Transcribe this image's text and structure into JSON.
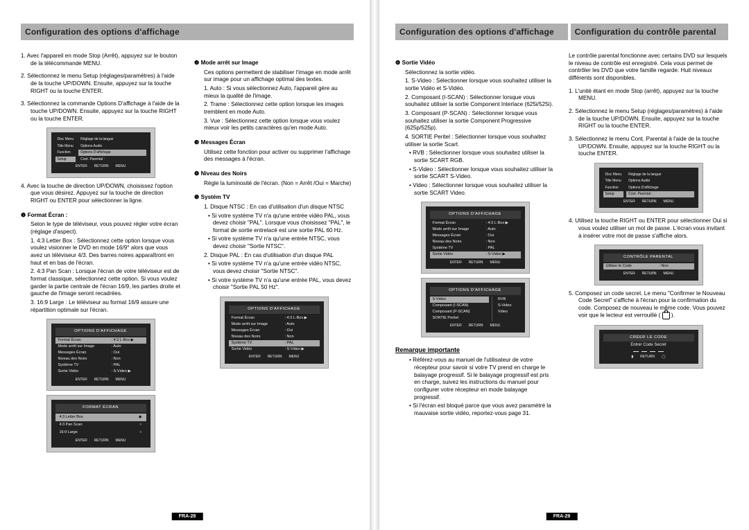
{
  "titles": {
    "leftA": "Configuration des options d'affichage",
    "rightA": "Configuration des options d'affichage",
    "rightB": "Configuration du contrôle parental"
  },
  "pageLeftNum": "FRA-28",
  "pageRightNum": "FRA-29",
  "left": {
    "steps": [
      "1. Avec l'appareil en mode Stop (Arrêt), appuyez sur le bouton de la télécommande MENU.",
      "2. Sélectionnez le menu Setup (réglages/paramètres) à l'aide de la touche UP/DOWN. Ensuite, appuyez sur la touche RIGHT ou la touche ENTER.",
      "3. Sélectionnez la commande Options D'affichage à l'aide de la touche UP/DOWN. Ensuite, appuyez sur la touche RIGHT ou la touche ENTER.",
      "4. Avec la touche de direction UP/DOWN, choisissez l'option que vous désirez. Appuyez sur la touche de direction RIGHT ou ENTER pour sélectionner la ligne."
    ],
    "formatEcranTitle": "❶ Format Écran :",
    "formatEcranIntro": "Selon le type de téléviseur, vous pouvez régler votre écran (réglage d'aspect).",
    "formatEcranItems": [
      "1. 4:3 Letter Box : Sélectionnez cette option lorsque vous voulez visionner le DVD en mode 16/9° alors que vous avez un téléviseur 4/3. Des barres noires apparaîtront en haut et en bas de l'écran.",
      "2. 4:3 Pan Scan : Lorsque l'écran de votre téléviseur est de format classique, sélectionnez cette option. Si vous voulez garder la partie centrale de l'écran 16/9, les parties droite et gauche de l'image seront recadrées.",
      "3. 16:9 Large : Le téléviseur au format 16/9 assure une répartition optimale sur l'écran."
    ],
    "col2": {
      "modeArret": "❷ Mode arrêt sur Image",
      "modeArretIntro": "Ces options permettent de stabiliser l'image en mode arrêt sur image pour un affichage optimal des textes.",
      "modeArretItems": [
        "1. Auto : Si vous sélectionnez Auto, l'appareil gère au mieux la qualité de l'image.",
        "2. Trame : Sélectionnez cette option lorsque les images tremblent en mode Auto.",
        "3. Vue : Sélectionnez cette option lorsque vous voulez mieux voir les petits caractères qu'en mode Auto."
      ],
      "messages": "❸ Messages Écran",
      "messagesBody": "Utilisez cette fonction pour activer ou supprimer l'affichage des messages à l'écran.",
      "noirs": "❹ Niveau des Noirs",
      "noirsBody": "Règle la luminosité de l'écran. (Non = Arrêt /Oui = Marche)",
      "systv": "❺ Systém TV",
      "systvItems": [
        "1. Disque NTSC : En cas d'utilisation d'un disque NTSC",
        "• Si votre système TV n'a qu'une entrée vidéo PAL, vous devez choisir \"PAL\". Lorsque vous choisissez \"PAL\", le format de sortie entrelacé est une sortie PAL 60 Hz.",
        "• Si votre système TV n'a qu'une entrée NTSC, vous devez choisir \"Sortie NTSC\".",
        "2. Disque PAL : En cas d'utilisation d'un disque PAL",
        "• Si votre système TV n'a qu'une entrée vidéo NTSC, vous devez choisir \"Sortie NTSC\".",
        "• Si votre système TV n'a qu'une entrée PAL, vous devez choisir \"Sortie PAL 50 Hz\"."
      ]
    }
  },
  "right": {
    "outputTitle": "❻ Sortie Vidéo",
    "outputIntro": "Sélectionnez la sortie vidéo.",
    "outputs": [
      "1. S-Video : Sélectionner lorsque vous souhaitez utiliser la sortie Vidéo et S-Vidéo.",
      "2. Composant (I-SCAN) : Sélectionner lorsque vous souhaitez utiliser la sortie Component Interlace (625i/525i).",
      "3. Composant (P-SCAN) : Sélectionner lorsque vous souhaitez utiliser la sortie Component Progressive (625p/525p).",
      "4. SORTIE Peritel : Sélectionner lorsque vous souhaitez utiliser la sortie Scart."
    ],
    "scartBullets": [
      "• RVB : Sélectionner lorsque vous souhaitez utiliser la sortie SCART RGB.",
      "• S-Video : Sélectionner lorsque vous souhaitez utiliser la sortie SCART S-Video.",
      "• Video : Sélectionner lorsque vous souhaitez utiliser la sortie SCART Video."
    ],
    "noteHead": "Remarque importante",
    "noteItems": [
      "• Référez-vous au manuel de l'utilisateur de votre récepteur pour savoir si votre TV prend en charge le balayage progressif. Si le balayage progressif est pris en charge, suivez les instructions du manuel pour configurer votre récepteur en mode balayage progressif.",
      "• Si l'écran est bloqué parce que vous avez paramétré la mauvaise sortie vidéo, reportez-vous page 31."
    ],
    "parental": {
      "intro": "Le contrôle parental fonctionne avec certains DVD sur lesquels le niveau de contrôle est enregistré. Cela vous permet de contrôler les DVD que votre famille regarde. Huit niveaux différents sont disponibles.",
      "steps": [
        "1. L'unité étant en mode Stop (arrêt), appuyez sur la touche MENU.",
        "2. Sélectionnez le menu Setup (réglages/paramètres) à l'aide de la touche UP/DOWN. Ensuite, appuyez sur la touche RIGHT ou la touche ENTER.",
        "3. Sélectionnez le menu Cont. Parental à l'aide de la touche UP/DOWN. Ensuite, appuyez sur la touche RIGHT ou la touche ENTER.",
        "4. Utilisez la touche RIGHT ou ENTER pour sélectionner Oui si vous voulez utiliser un mot de passe. L'écran vous invitant à insérer votre mot de passe s'affiche alors.",
        "5. Composez un code secret. Le menu \"Confirmer le Nouveau Code Secret\" s'affiche à l'écran pour la confirmation du code. Composez de nouveau le même code. Vous pouvez voir que le lecteur est verrouillé ( "
      ],
      "lockTail": " )."
    }
  },
  "menus": {
    "footer": [
      "ENTER",
      "RETURN",
      "MENU"
    ],
    "sideNav": [
      "Disc Menu",
      "Title Menu",
      "Function",
      "Setup"
    ],
    "setupItems": [
      "Réglage de la langue",
      "Options Audio",
      "Options D'affichage",
      "Cont. Parental :"
    ],
    "optionsHeader": "OPTIONS D'AFFICHAGE",
    "optionsRows": [
      {
        "k": "Format Écran",
        "v": ": 4:3 L-Box ▶",
        "sel": true
      },
      {
        "k": "Mode arrêt sur Image",
        "v": ": Auto"
      },
      {
        "k": "Messages Écran",
        "v": ": Oui"
      },
      {
        "k": "Niveau des Noirs",
        "v": ": Non"
      },
      {
        "k": "Système TV",
        "v": ": PAL"
      },
      {
        "k": "Sortie Vidéo",
        "v": ": S-Video ▶"
      }
    ],
    "optionsRows2": [
      {
        "k": "Format Écran",
        "v": ": 4:3 L-Box ▶"
      },
      {
        "k": "Mode arrêt sur Image",
        "v": ": Auto"
      },
      {
        "k": "Messages Écran",
        "v": ": Oui"
      },
      {
        "k": "Niveau des Noirs",
        "v": ": Non"
      },
      {
        "k": "Système TV",
        "v": ": PAL",
        "sel": true
      },
      {
        "k": "Sortie Vidéo",
        "v": ": S-Video ▶"
      }
    ],
    "optionsRows3": [
      {
        "k": "Format Écran",
        "v": ": 4:3 L-Box ▶"
      },
      {
        "k": "Mode arrêt sur Image",
        "v": ": Auto"
      },
      {
        "k": "Messages Écran",
        "v": ": Oui"
      },
      {
        "k": "Niveau des Noirs",
        "v": ": Non"
      },
      {
        "k": "Système TV",
        "v": ": PAL"
      },
      {
        "k": "Sortie Vidéo",
        "v": ": S-Video ▶",
        "sel": true
      }
    ],
    "formatHeader": "FORMAT ÉCRAN",
    "formatRows": [
      {
        "label": "4:3 Letter Box",
        "sel": true
      },
      {
        "label": "4:3 Pan Scan"
      },
      {
        "label": "16:9 Large"
      }
    ],
    "scartRows": [
      {
        "k": "S-Video",
        "sel": true
      },
      {
        "k": "Composant (I-SCAN)"
      },
      {
        "k": "Composant (P-SCAN)"
      },
      {
        "k": "SORTIE Peritel"
      }
    ],
    "scartSub": [
      "RVB",
      "S-Video",
      "Video"
    ],
    "parentalHeader": "CONTRÔLE PARENTAL",
    "parentalRow": {
      "k": "Utiliser le Code",
      "v": ": Non"
    },
    "codeHeader": "CRÉER LE CODE",
    "codeLabel": "Entrer Code Secret"
  }
}
